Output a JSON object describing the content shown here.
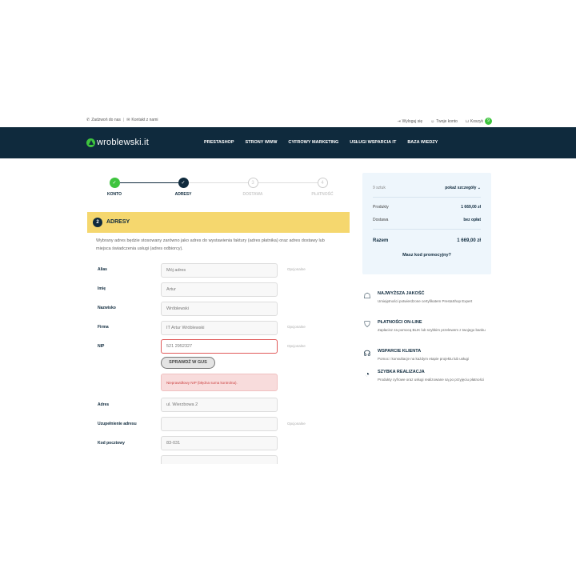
{
  "topbar": {
    "call": "Zadzwoń do nas",
    "separator": "|",
    "contact": "Kontakt z nami",
    "logout": "Wyloguj się",
    "account": "Twoje konto",
    "cart": "Koszyk",
    "cart_count": "9"
  },
  "nav": {
    "logo": "wroblewski.it",
    "items": [
      "PRESTASHOP",
      "STRONY WWW",
      "CYFROWY MARKETING",
      "USŁUGI WSPARCIA IT",
      "BAZA WIEDZY"
    ]
  },
  "steps": [
    {
      "label": "KONTO",
      "state": "done",
      "mark": "✓"
    },
    {
      "label": "ADRESY",
      "state": "current",
      "mark": "✓"
    },
    {
      "label": "DOSTAWA",
      "state": "todo",
      "mark": "3"
    },
    {
      "label": "PŁATNOŚĆ",
      "state": "todo",
      "mark": "4"
    }
  ],
  "section": {
    "number": "2",
    "title": "ADRESY",
    "intro": "Wybrany adres będzie stosowany zarówno jako adres do wystawienia faktury (adres płatnika) oraz adres dostawy lub miejsca świadczenia usługi (adres odbiorcy)."
  },
  "form": {
    "optional_label": "Opcjonalne",
    "alias": {
      "label": "Alias",
      "value": "Mój adres"
    },
    "firstname": {
      "label": "Imię",
      "value": "Artur"
    },
    "lastname": {
      "label": "Nazwisko",
      "value": "Wróblewski"
    },
    "company": {
      "label": "Firma",
      "value": "IT Artur Wróblewski"
    },
    "nip": {
      "label": "NIP",
      "value": "521 2952327"
    },
    "gus_button": "SPRAWDŹ W GUS",
    "nip_error": "Nieprawidłowy NIP (błędna suma kontrolna).",
    "address": {
      "label": "Adres",
      "value": "ul. Wierzbowa 2"
    },
    "address2": {
      "label": "Uzupełnienie adresu",
      "value": ""
    },
    "postcode": {
      "label": "Kod pocztowy",
      "value": "83-031"
    }
  },
  "summary": {
    "items_count": "9 sztuk",
    "details_link": "pokaż szczegóły",
    "products_label": "Produkty",
    "products_value": "1 669,00 zł",
    "shipping_label": "Dostawa",
    "shipping_value": "bez opłat",
    "total_label": "Razem",
    "total_value": "1 669,00 zł",
    "promo": "Masz kod promocyjny?"
  },
  "features": [
    {
      "icon": "badge-icon",
      "title": "NAJWYŻSZA JAKOŚĆ",
      "desc": "Umiejętności potwierdzone certyfikatem PrestaShop Expert"
    },
    {
      "icon": "shield-icon",
      "title": "PŁATNOŚCI ON-LINE",
      "desc": "Zapłacisz za pomocą BLIK lub szybkim przelewem z twojego banku"
    },
    {
      "icon": "headset-icon",
      "title": "WSPARCIE KLIENTA",
      "desc": "Pomoc i konsultacje na każdym etapie projektu lub usługi"
    },
    {
      "icon": "speedometer-icon",
      "title": "SZYBKA REALIZACJA",
      "desc": "Produkty cyfrowe oraz usługi realizowane są po przyjęciu płatności"
    }
  ],
  "colors": {
    "navy": "#0f2a3d",
    "green": "#3ec43e",
    "yellow": "#f5d76e",
    "error": "#e05a5a"
  }
}
